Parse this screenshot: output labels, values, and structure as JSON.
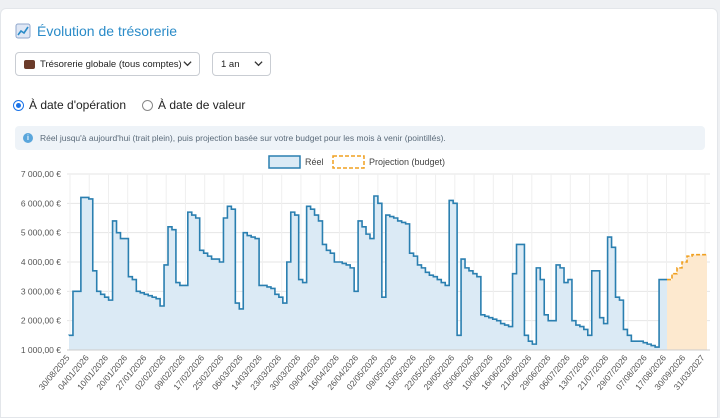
{
  "header": {
    "title": "Évolution de trésorerie",
    "icon": "chart-line-icon"
  },
  "filters": {
    "account": {
      "selected": "Trésorerie globale (tous comptes)"
    },
    "period": {
      "selected": "1 an"
    }
  },
  "date_mode": {
    "options": [
      {
        "label": "À date d'opération",
        "selected": true
      },
      {
        "label": "À date de valeur",
        "selected": false
      }
    ]
  },
  "info_text": "Réel jusqu'à aujourd'hui (trait plein), puis projection basée sur votre budget pour les mois à venir (pointillés).",
  "colors": {
    "accent": "#2a8bc8",
    "real_line": "#2a7fb0",
    "real_fill": "#dbeaf5",
    "projection_line": "#f0a020",
    "projection_fill": "#fde9cf"
  },
  "chart_data": {
    "type": "area",
    "ylim": [
      1000,
      7000
    ],
    "yticks": [
      "1 000,00 €",
      "2 000,00 €",
      "3 000,00 €",
      "4 000,00 €",
      "5 000,00 €",
      "6 000,00 €",
      "7 000,00 €"
    ],
    "ytick_values": [
      1000,
      2000,
      3000,
      4000,
      5000,
      6000,
      7000
    ],
    "xtick_labels": [
      "30/08/2025",
      "04/01/2026",
      "10/01/2026",
      "20/01/2026",
      "27/01/2026",
      "02/02/2026",
      "09/02/2026",
      "17/02/2026",
      "25/02/2026",
      "06/03/2026",
      "14/03/2026",
      "23/03/2026",
      "30/03/2026",
      "09/04/2026",
      "16/04/2026",
      "26/04/2026",
      "02/05/2026",
      "09/05/2026",
      "15/05/2026",
      "22/05/2026",
      "29/05/2026",
      "05/06/2026",
      "10/06/2026",
      "16/06/2026",
      "21/06/2026",
      "29/06/2026",
      "06/07/2026",
      "13/07/2026",
      "21/07/2026",
      "29/07/2026",
      "07/08/2026",
      "17/08/2026",
      "30/09/2026",
      "31/03/2027"
    ],
    "legend": {
      "position": "top-center"
    },
    "series": [
      {
        "name": "Réel",
        "style": "solid-step",
        "values": [
          1500,
          3000,
          3000,
          6200,
          6200,
          6150,
          3700,
          3000,
          2900,
          2800,
          2700,
          5400,
          5000,
          4800,
          4800,
          3500,
          3400,
          3000,
          2950,
          2900,
          2850,
          2800,
          2750,
          2500,
          3900,
          5200,
          5100,
          3300,
          3200,
          3200,
          5700,
          5600,
          5500,
          4400,
          4300,
          4200,
          4100,
          4100,
          4000,
          5500,
          5900,
          5800,
          2600,
          2400,
          5000,
          4900,
          4850,
          4800,
          3200,
          3200,
          3150,
          3100,
          2900,
          2800,
          2600,
          4000,
          5700,
          5600,
          3400,
          3300,
          5900,
          5800,
          5600,
          5400,
          4600,
          4400,
          4300,
          4000,
          4000,
          3950,
          3900,
          3800,
          3000,
          5400,
          5200,
          4950,
          4800,
          6250,
          6000,
          2800,
          5600,
          5550,
          5500,
          5400,
          5350,
          5300,
          4300,
          4200,
          3900,
          3800,
          3650,
          3550,
          3500,
          3400,
          3300,
          3200,
          6100,
          6000,
          1500,
          4100,
          3800,
          3700,
          3600,
          3500,
          2200,
          2150,
          2100,
          2050,
          2000,
          1900,
          1850,
          1800,
          3600,
          4600,
          4600,
          1500,
          1300,
          1200,
          3800,
          3400,
          2200,
          2000,
          2000,
          3900,
          3800,
          3300,
          3400,
          2000,
          1850,
          1800,
          1700,
          1500,
          3700,
          3700,
          2100,
          1900,
          4850,
          4500,
          2800,
          2700,
          1700,
          1500,
          1300,
          1300,
          1300,
          1250,
          1200,
          1150,
          1100,
          3400,
          3400
        ]
      },
      {
        "name": "Projection (budget)",
        "style": "dashed-step",
        "values": [
          3400,
          3600,
          3800,
          4000,
          4200,
          4250,
          4250,
          4250
        ]
      }
    ]
  }
}
